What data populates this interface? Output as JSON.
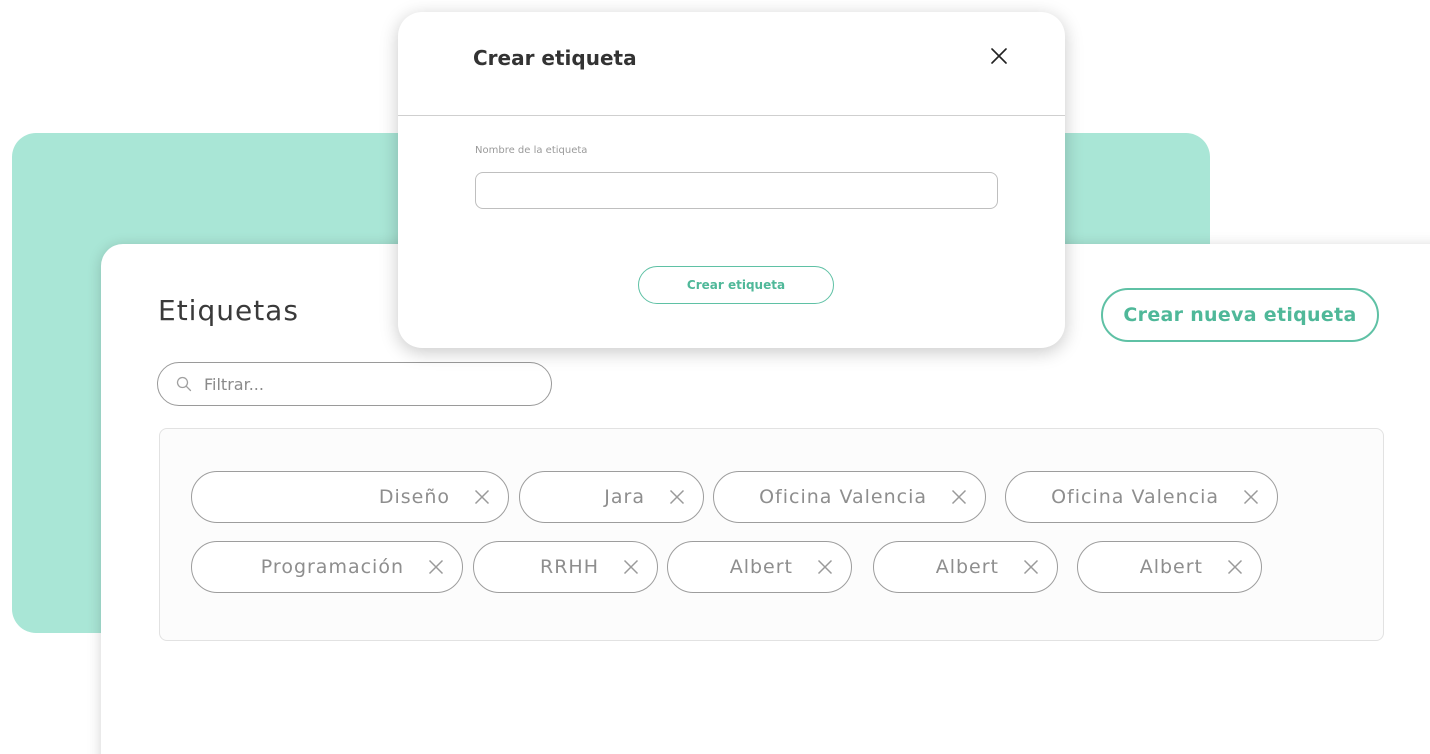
{
  "theme": {
    "accent": "#5fc1a5",
    "mint": "#a9e6d6"
  },
  "tags_panel": {
    "title": "Etiquetas",
    "create_button_label": "Crear nueva etiqueta",
    "filter_placeholder": "Filtrar...",
    "tags": [
      {
        "label": "Diseño"
      },
      {
        "label": "Jara"
      },
      {
        "label": "Oficina Valencia"
      },
      {
        "label": "Oficina Valencia"
      },
      {
        "label": "Programación"
      },
      {
        "label": "RRHH"
      },
      {
        "label": "Albert"
      },
      {
        "label": "Albert"
      },
      {
        "label": "Albert"
      }
    ]
  },
  "modal": {
    "title": "Crear etiqueta",
    "field_label": "Nombre de la etiqueta",
    "field_value": "",
    "submit_label": "Crear etiqueta",
    "close_icon": "close-icon"
  }
}
